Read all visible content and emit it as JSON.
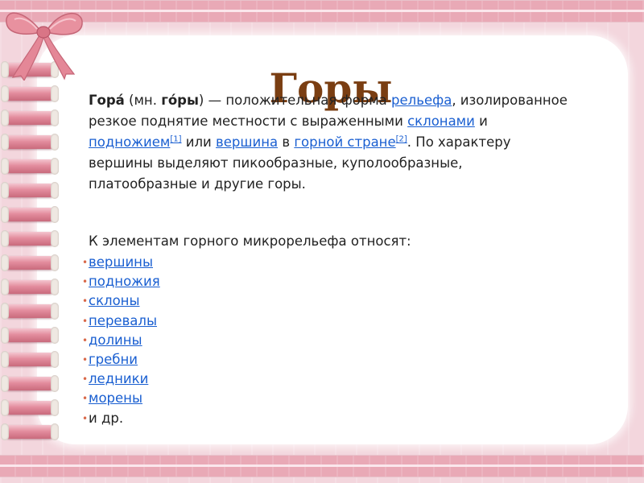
{
  "slide": {
    "title": "Горы",
    "paragraph": {
      "term": "Гора́",
      "p1": " (мн. ",
      "plural": "го́ры",
      "p2": ") — положительная форма ",
      "link_relief": "рельефа",
      "p3": ", изолированное резкое поднятие местности с выраженными ",
      "link_slopes": "склонами",
      "p4": " и ",
      "link_foot": "подножием",
      "ref1": "[1]",
      "p5": " или ",
      "link_peak": "вершина",
      "p6": " в ",
      "link_mountain_country": "горной стране",
      "ref2": "[2]",
      "p7": ". По характеру вершины выделяют пикообразные, куполообразные, платообразные и другие горы."
    },
    "list_intro": "К элементам горного микрорельефа относят:",
    "bullet_color": "#d9694a",
    "list": [
      {
        "text": "вершины",
        "link": true
      },
      {
        "text": "подножия",
        "link": true
      },
      {
        "text": "склоны",
        "link": true
      },
      {
        "text": "перевалы",
        "link": true
      },
      {
        "text": "долины",
        "link": true
      },
      {
        "text": "гребни",
        "link": true
      },
      {
        "text": "ледники",
        "link": true
      },
      {
        "text": "морены",
        "link": true
      },
      {
        "text": "и др.",
        "link": false
      }
    ]
  },
  "theme": {
    "title_color": "#7a3e12",
    "link_color": "#1a5fd1",
    "ribbon_color": "#e38d9e",
    "background_color": "#f3d6dd"
  }
}
